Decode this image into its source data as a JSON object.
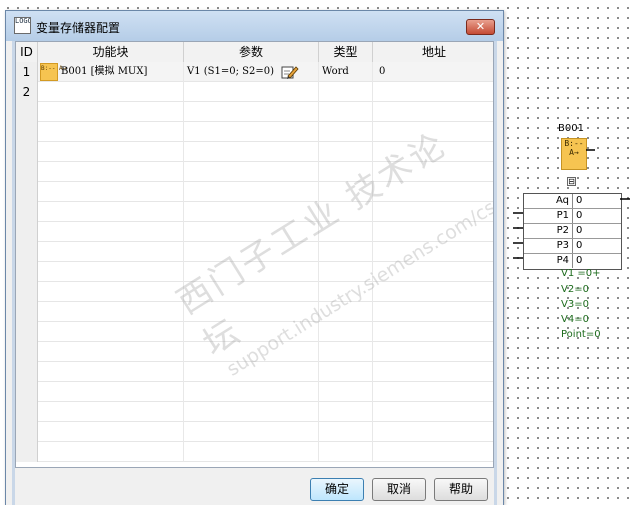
{
  "dialog": {
    "title": "变量存储器配置",
    "icon_text": "LOGO",
    "close_label": "✕",
    "columns": [
      "ID",
      "功能块",
      "参数",
      "类型",
      "地址"
    ],
    "rows": [
      {
        "id": "1",
        "block_icon_text": "B:-- A→",
        "block": "B001 [模拟 MUX]",
        "param": "V1 (S1=0; S2=0)",
        "type": "Word",
        "address": "0"
      },
      {
        "id": "2",
        "block_icon_text": "",
        "block": "",
        "param": "",
        "type": "",
        "address": ""
      }
    ],
    "buttons": {
      "ok": "确定",
      "cancel": "取消",
      "help": "帮助"
    },
    "watermark": {
      "cn": "西门子工业  技术论坛",
      "url": "support.industry.siemens.com/cs"
    }
  },
  "block": {
    "name": "B001",
    "icon_text": "B:-- A→",
    "collapse": "⊟",
    "params": [
      {
        "name": "Aq",
        "value": "0"
      },
      {
        "name": "P1",
        "value": "0"
      },
      {
        "name": "P2",
        "value": "0"
      },
      {
        "name": "P3",
        "value": "0"
      },
      {
        "name": "P4",
        "value": "0"
      }
    ],
    "values": [
      "V1 =0+",
      "V2=0",
      "V3=0",
      "V4=0",
      "Point=0"
    ]
  },
  "colors": {
    "accent": "#3c7fb1",
    "block_fill": "#f6c451",
    "value_text": "#1d6b1d"
  }
}
